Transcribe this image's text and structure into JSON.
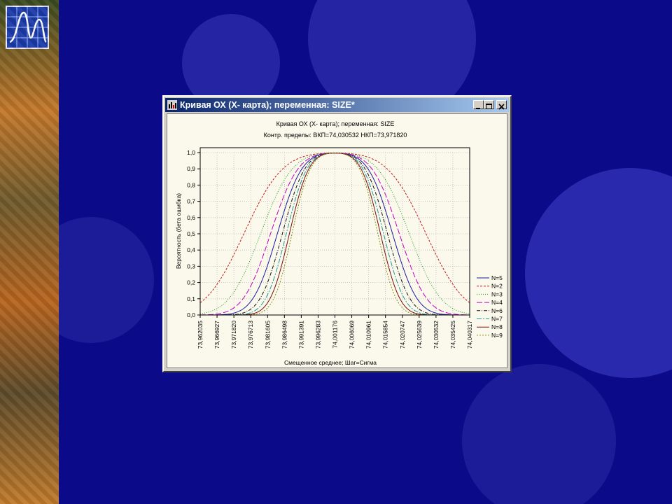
{
  "window": {
    "title": "Кривая ОХ (Х- карта); переменная: SIZE*",
    "controls": {
      "minimize": "_",
      "maximize": "□",
      "close": "×"
    }
  },
  "icons": {
    "logo": "chart-logo-icon",
    "app": "statistica-app-icon"
  },
  "colors": {
    "desktop": "#0b0b8a",
    "titlebar": "#0a246a",
    "plot_bg": "#fbf9ec"
  },
  "chart_data": {
    "type": "line",
    "title": "Кривая ОХ (Х- карта); переменная: SIZE",
    "subtitle": "Контр. пределы: ВКП=74,030532 НКП=73,971820",
    "xlabel": "Смещенное среднее; Шаг=Сигма",
    "ylabel": "Вероятность (бета ошибка)",
    "ylim": [
      0,
      1
    ],
    "yticks": [
      "0,0",
      "0,1",
      "0,2",
      "0,3",
      "0,4",
      "0,5",
      "0,6",
      "0,7",
      "0,8",
      "0,9",
      "1,0"
    ],
    "x_categories": [
      "73,962035",
      "73,966927",
      "73,971820",
      "73,976713",
      "73,981605",
      "73,986498",
      "73,991391",
      "73,996283",
      "74,001176",
      "74,006069",
      "74,010961",
      "74,015854",
      "74,020747",
      "74,025639",
      "74,030532",
      "74,035425",
      "74,040317"
    ],
    "grid": true,
    "legend_position": "right",
    "series": [
      {
        "name": "N=5",
        "n": 5,
        "color": "#1a1aa0",
        "dash": ""
      },
      {
        "name": "N=2",
        "n": 2,
        "color": "#c01818",
        "dash": "3,2"
      },
      {
        "name": "N=3",
        "n": 3,
        "color": "#1a9a1a",
        "dash": "1,2"
      },
      {
        "name": "N=4",
        "n": 4,
        "color": "#c000c0",
        "dash": "8,3"
      },
      {
        "name": "N=6",
        "n": 6,
        "color": "#111111",
        "dash": "5,2,1,2"
      },
      {
        "name": "N=7",
        "n": 7,
        "color": "#1a9a9a",
        "dash": "7,2,2,2"
      },
      {
        "name": "N=8",
        "n": 8,
        "color": "#7a0a0a",
        "dash": ""
      },
      {
        "name": "N=9",
        "n": 9,
        "color": "#8a8a10",
        "dash": "2,2"
      }
    ]
  }
}
